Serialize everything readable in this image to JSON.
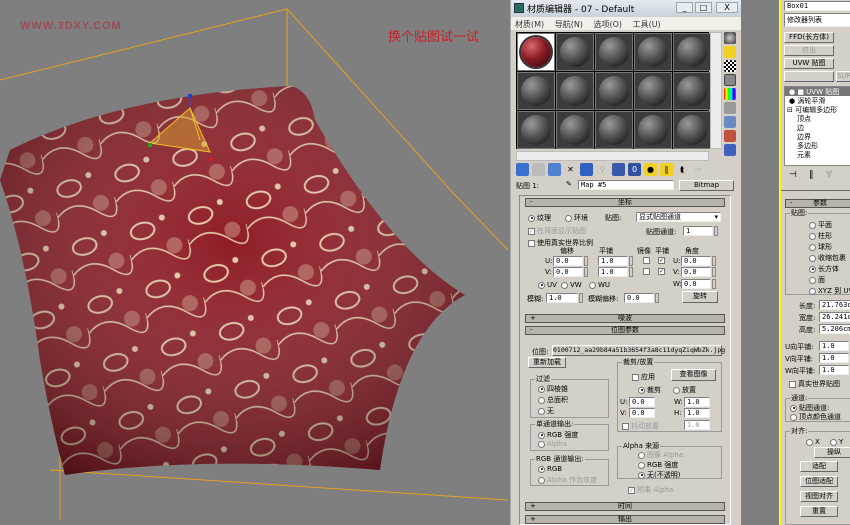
{
  "viewport": {
    "watermark": "WWW.3DXY.COM",
    "annotation": "换个贴图试一试",
    "gizmo_axes": [
      "z",
      "x",
      "y"
    ]
  },
  "material_editor": {
    "title": "材质编辑器 - 07 - Default",
    "window_buttons": [
      "_",
      "□",
      "X"
    ],
    "menu": [
      "材质(M)",
      "导航(N)",
      "选项(O)",
      "工具(U)"
    ],
    "slot_count": 15,
    "selected_slot": 0,
    "map_label": "贴图 1:",
    "map_name": "Map #5",
    "map_type": "Bitmap",
    "coordinates": {
      "header": "坐标",
      "texture": "纹理",
      "environ": "环境",
      "mapping_label": "贴图:",
      "mapping_value": "显式贴图通道",
      "show_back": "在背面显示贴图",
      "map_channel_label": "贴图通道:",
      "map_channel": "1",
      "real_world": "使用真实世界比例",
      "offset": "偏移",
      "tiling": "平铺",
      "mirror": "镜像",
      "tile": "平铺",
      "angle": "角度",
      "u_label": "U:",
      "v_label": "V:",
      "w_label": "W:",
      "u_offset": "0.0",
      "v_offset": "0.0",
      "u_tiling": "1.0",
      "v_tiling": "1.0",
      "u_angle": "0.0",
      "v_angle": "0.0",
      "w_angle": "0.0",
      "uv": "UV",
      "vw": "VW",
      "wu": "WU",
      "blur_label": "模糊:",
      "blur": "1.0",
      "blur_offset_label": "模糊偏移:",
      "blur_offset": "0.0",
      "rotate": "旋转"
    },
    "noise_header": "噪波",
    "bitmap_params": {
      "header": "位图参数",
      "bitmap_label": "位图:",
      "bitmap_path": "0100712_aa29b84a51b3654f3a8c11dyqZiqWbZk.jpg",
      "reload": "重新加载",
      "filtering": "过滤",
      "filter_opts": [
        "四棱锥",
        "总面积",
        "无"
      ],
      "mono_output": "单通道输出:",
      "mono_opts": [
        "RGB 强度",
        "Alpha"
      ],
      "rgb_output": "RGB 通道输出:",
      "rgb_opts": [
        "RGB",
        "Alpha 作为灰度"
      ],
      "crop_place": "裁剪/放置",
      "apply": "应用",
      "view_image": "查看图像",
      "crop": "裁剪",
      "place": "放置",
      "u_val": "0.0",
      "v_val": "0.0",
      "w_val": "1.0",
      "h_val": "1.0",
      "u_label": "U:",
      "v_label": "V:",
      "w_label": "W:",
      "h_label": "H:",
      "jitter": "抖动放置",
      "jitter_val": "1.0",
      "alpha_source": "Alpha 来源",
      "alpha_opts": [
        "图像 Alpha",
        "RGB 强度",
        "无(不透明)"
      ],
      "premult": "预乘 Alpha"
    },
    "time_header": "时间",
    "output_header": "输出"
  },
  "command_panel": {
    "object_name": "Box01",
    "modifier_list": "修改器列表",
    "buttons": [
      "FFD(长方体)",
      "挤出",
      "UVW 贴图",
      "SURF"
    ],
    "stack": [
      "UVW 贴图",
      "涡轮平滑",
      "可编辑多边形",
      "顶点",
      "边",
      "边界",
      "多边形",
      "元素"
    ],
    "params_header": "参数",
    "mapping_group": "贴图:",
    "mapping_opts": [
      "平面",
      "柱形",
      "球形",
      "收缩包裹",
      "长方体",
      "面",
      "XYZ 到 UVW"
    ],
    "length_label": "长度:",
    "length": "21.763c",
    "width_label": "宽度:",
    "width": "26.241c",
    "height_label": "高度:",
    "height": "5.206cm",
    "u_tile_label": "U向平铺:",
    "u_tile": "1.0",
    "v_tile_label": "V向平铺:",
    "v_tile": "1.0",
    "w_tile_label": "W向平铺:",
    "w_tile": "1.0",
    "real_world": "真实世界贴图",
    "channel_group": "通道:",
    "channel_opts": [
      "贴图通道:",
      "顶点颜色通道"
    ],
    "align_group": "对齐:",
    "align_axes": [
      "X",
      "Y"
    ],
    "manipulate": "操纵",
    "fit": "适配",
    "bitmap_fit": "位图适配",
    "view_align": "视图对齐",
    "reset": "重置"
  },
  "colors": {
    "viewport_bg": "#7f7f7f",
    "bbox": "#e8a020",
    "fabric": "#8e1c26",
    "selection": "#ffff00"
  }
}
